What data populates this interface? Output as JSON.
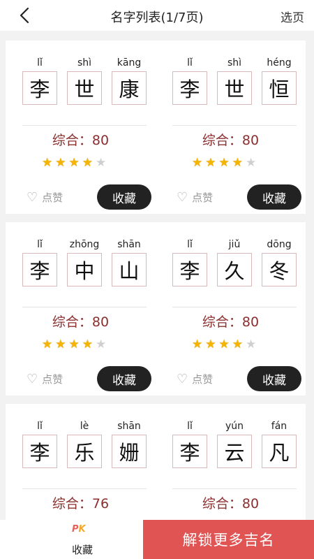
{
  "header": {
    "title": "名字列表(1/7页)",
    "select_page": "选页"
  },
  "cards": [
    {
      "chars": [
        {
          "py": "lǐ",
          "ch": "李"
        },
        {
          "py": "shì",
          "ch": "世"
        },
        {
          "py": "kāng",
          "ch": "康"
        }
      ],
      "score": "综合：80",
      "stars": 4,
      "like_label": "点赞",
      "fav_label": "收藏"
    },
    {
      "chars": [
        {
          "py": "lǐ",
          "ch": "李"
        },
        {
          "py": "shì",
          "ch": "世"
        },
        {
          "py": "héng",
          "ch": "恒"
        }
      ],
      "score": "综合：80",
      "stars": 4,
      "like_label": "点赞",
      "fav_label": "收藏"
    },
    {
      "chars": [
        {
          "py": "lǐ",
          "ch": "李"
        },
        {
          "py": "zhōng",
          "ch": "中"
        },
        {
          "py": "shān",
          "ch": "山"
        }
      ],
      "score": "综合：80",
      "stars": 4,
      "like_label": "点赞",
      "fav_label": "收藏"
    },
    {
      "chars": [
        {
          "py": "lǐ",
          "ch": "李"
        },
        {
          "py": "jiǔ",
          "ch": "久"
        },
        {
          "py": "dōng",
          "ch": "冬"
        }
      ],
      "score": "综合：80",
      "stars": 4,
      "like_label": "点赞",
      "fav_label": "收藏"
    },
    {
      "chars": [
        {
          "py": "lǐ",
          "ch": "李"
        },
        {
          "py": "lè",
          "ch": "乐"
        },
        {
          "py": "shān",
          "ch": "姗"
        }
      ],
      "score": "综合：76"
    },
    {
      "chars": [
        {
          "py": "lǐ",
          "ch": "李"
        },
        {
          "py": "yún",
          "ch": "云"
        },
        {
          "py": "fán",
          "ch": "凡"
        }
      ],
      "score": "综合：80"
    }
  ],
  "bottom": {
    "pk_icon": [
      "P",
      "K"
    ],
    "pk_label": "收藏",
    "unlock_label": "解锁更多吉名"
  },
  "icons": {
    "back": "chevron-left-icon",
    "heart": "heart-outline-icon",
    "star": "star-icon"
  },
  "colors": {
    "score_text": "#8b2e2e",
    "star_on": "#f4b400",
    "star_off": "#cfcfcf",
    "fav_button": "#222222",
    "unlock_button": "#e15454"
  }
}
